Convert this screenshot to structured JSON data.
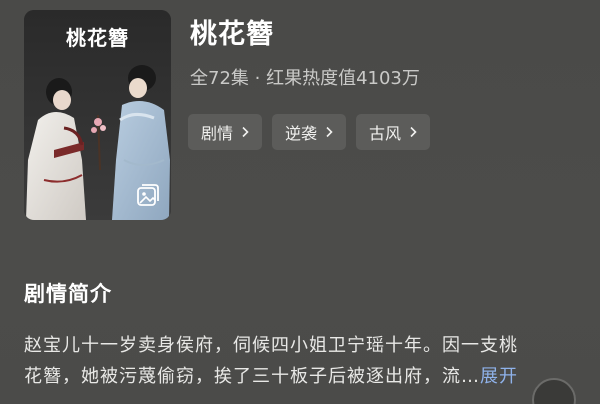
{
  "drama": {
    "poster_title": "桃花簪",
    "title": "桃花簪",
    "meta": "全72集 · 红果热度值4103万",
    "poster_icon": "gallery-icon"
  },
  "tags": [
    {
      "label": "剧情"
    },
    {
      "label": "逆袭"
    },
    {
      "label": "古风"
    }
  ],
  "synopsis": {
    "heading": "剧情简介",
    "line1": "赵宝儿十一岁卖身侯府，伺候四小姐卫宁瑶十年。因一支桃",
    "line2": "花簪，她被污蔑偷窃，挨了三十板子后被逐出府，流…",
    "expand_label": "展开"
  },
  "colors": {
    "background": "#4b4b49",
    "tag_background": "#5c5c5a",
    "expand_link": "#8fb2ea",
    "meta_text": "#c9c9c7"
  }
}
